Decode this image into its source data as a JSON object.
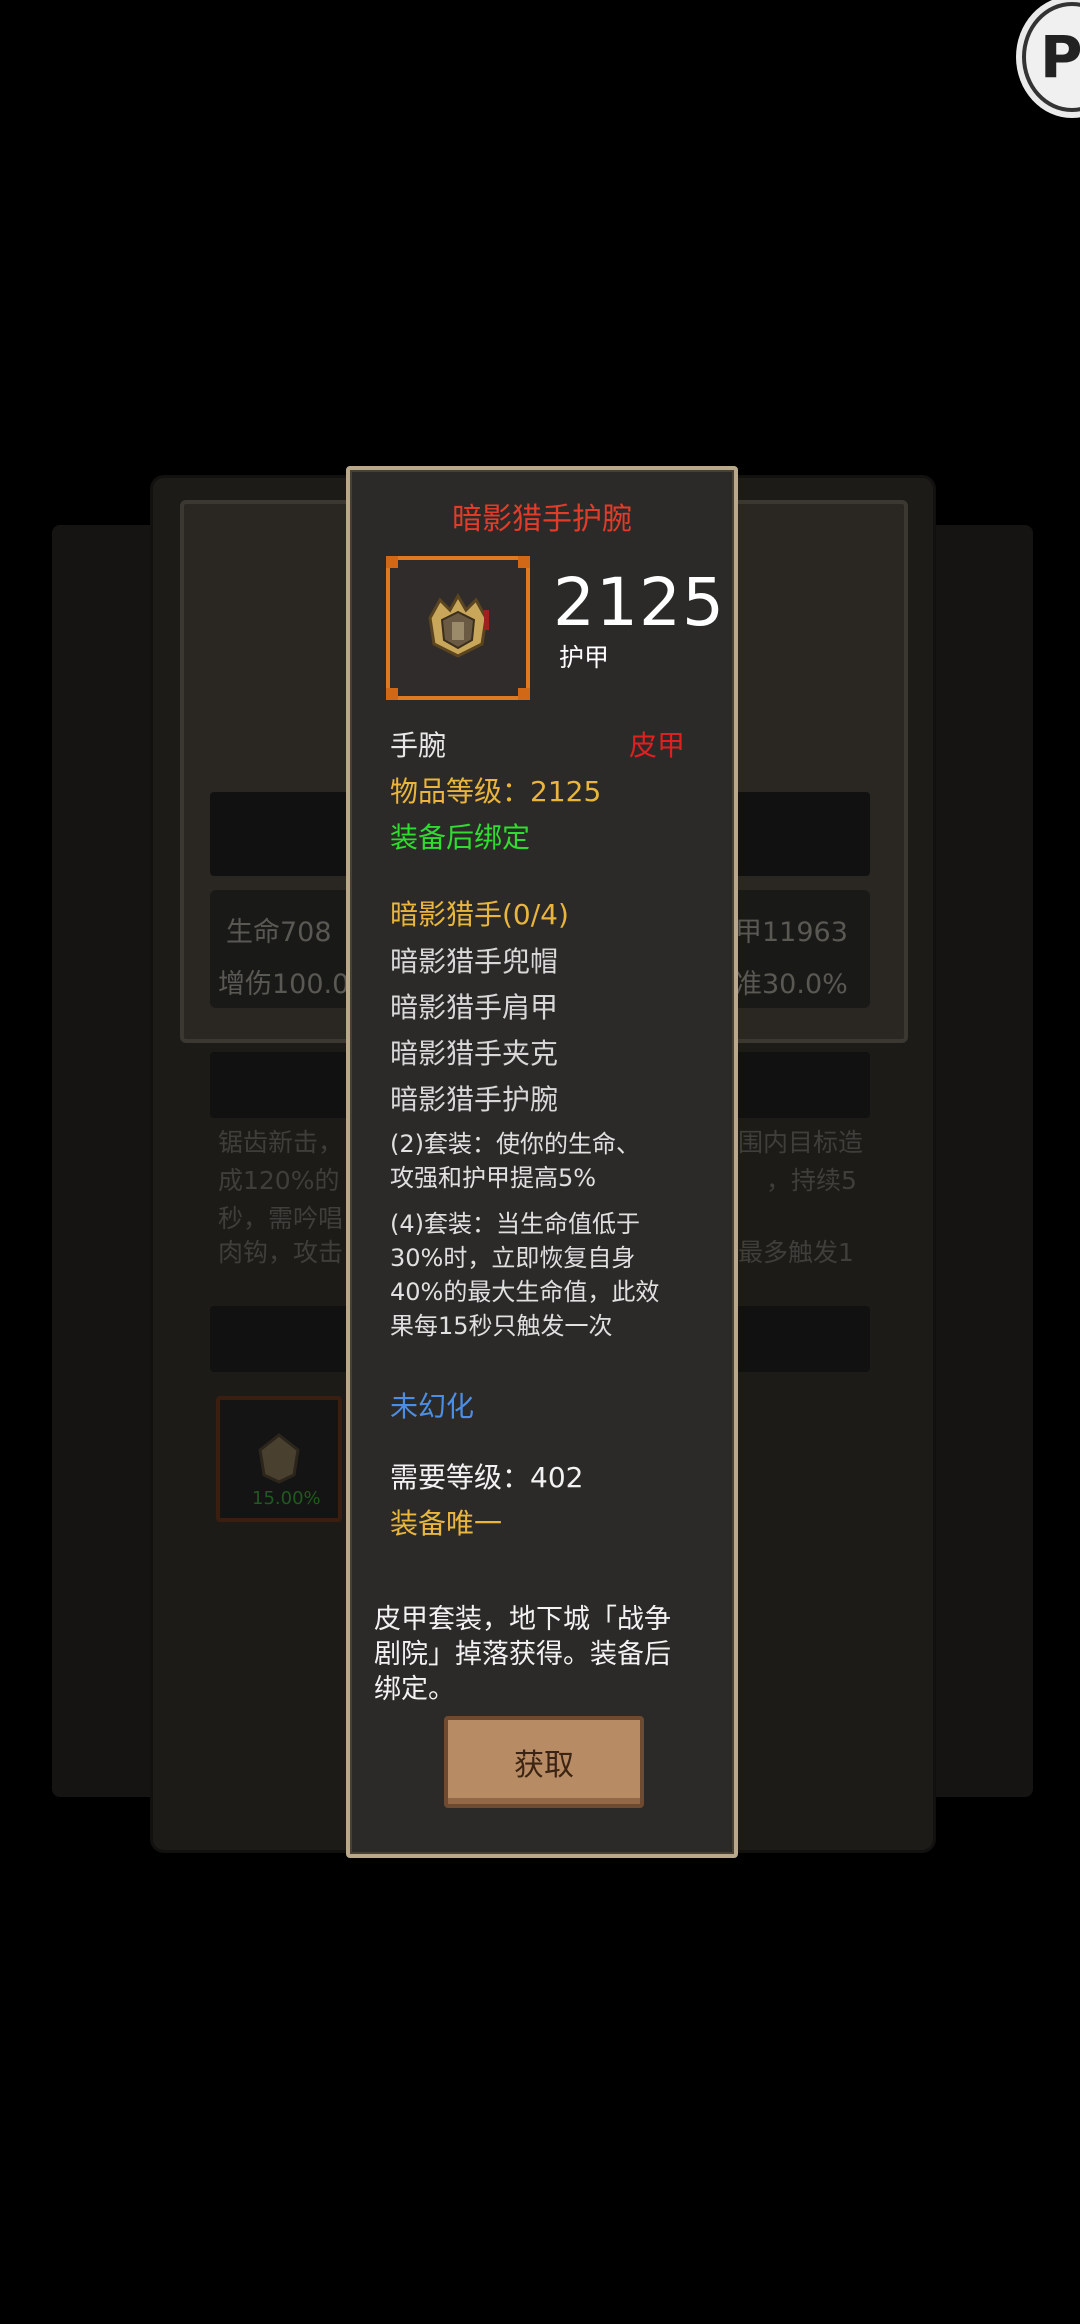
{
  "tooltip": {
    "title": "暗影猎手护腕",
    "armor_value": "2125",
    "armor_label": "护甲",
    "slot_type": "手腕",
    "armor_type": "皮甲",
    "item_level": "物品等级：2125",
    "bind": "装备后绑定",
    "set_name": "暗影猎手(0/4)",
    "set_items": [
      "暗影猎手兜帽",
      "暗影猎手肩甲",
      "暗影猎手夹克",
      "暗影猎手护腕"
    ],
    "bonus_2_line1": "(2)套装：使你的生命、",
    "bonus_2_line2": "攻强和护甲提高5%",
    "bonus_4_line1": "(4)套装：当生命值低于",
    "bonus_4_line2": "30%时，立即恢复自身",
    "bonus_4_line3": "40%的最大生命值，此效",
    "bonus_4_line4": "果每15秒只触发一次",
    "transmog": "未幻化",
    "required_level": "需要等级：402",
    "unique": "装备唯一",
    "description_line1": "皮甲套装，地下城「战争",
    "description_line2": "剧院」掉落获得。装备后",
    "description_line3": "绑定。",
    "get_button": "获取"
  },
  "background": {
    "stat_left_1": "生命708",
    "stat_left_2": "增伤100.0",
    "stat_right_1": "甲11963",
    "stat_right_2": "准30.0%",
    "skill_line1_left": "锯齿新击，",
    "skill_line1_right": "围内目标造",
    "skill_line2_left": "成120%的",
    "skill_line2_right": "，持续5",
    "skill_line3_left": "秒，需吟唱",
    "skill_line4_left": "肉钩，攻击",
    "skill_line4_right": "最多触发1",
    "slot_percent": "15.00%"
  },
  "corner_button": {
    "label": "P"
  },
  "colors": {
    "title_red": "#e03c2a",
    "quality_orange": "#e07a20",
    "yellow": "#e9b53c",
    "green": "#2fdc2f",
    "blue": "#4c8ee6",
    "red": "#e02020"
  }
}
